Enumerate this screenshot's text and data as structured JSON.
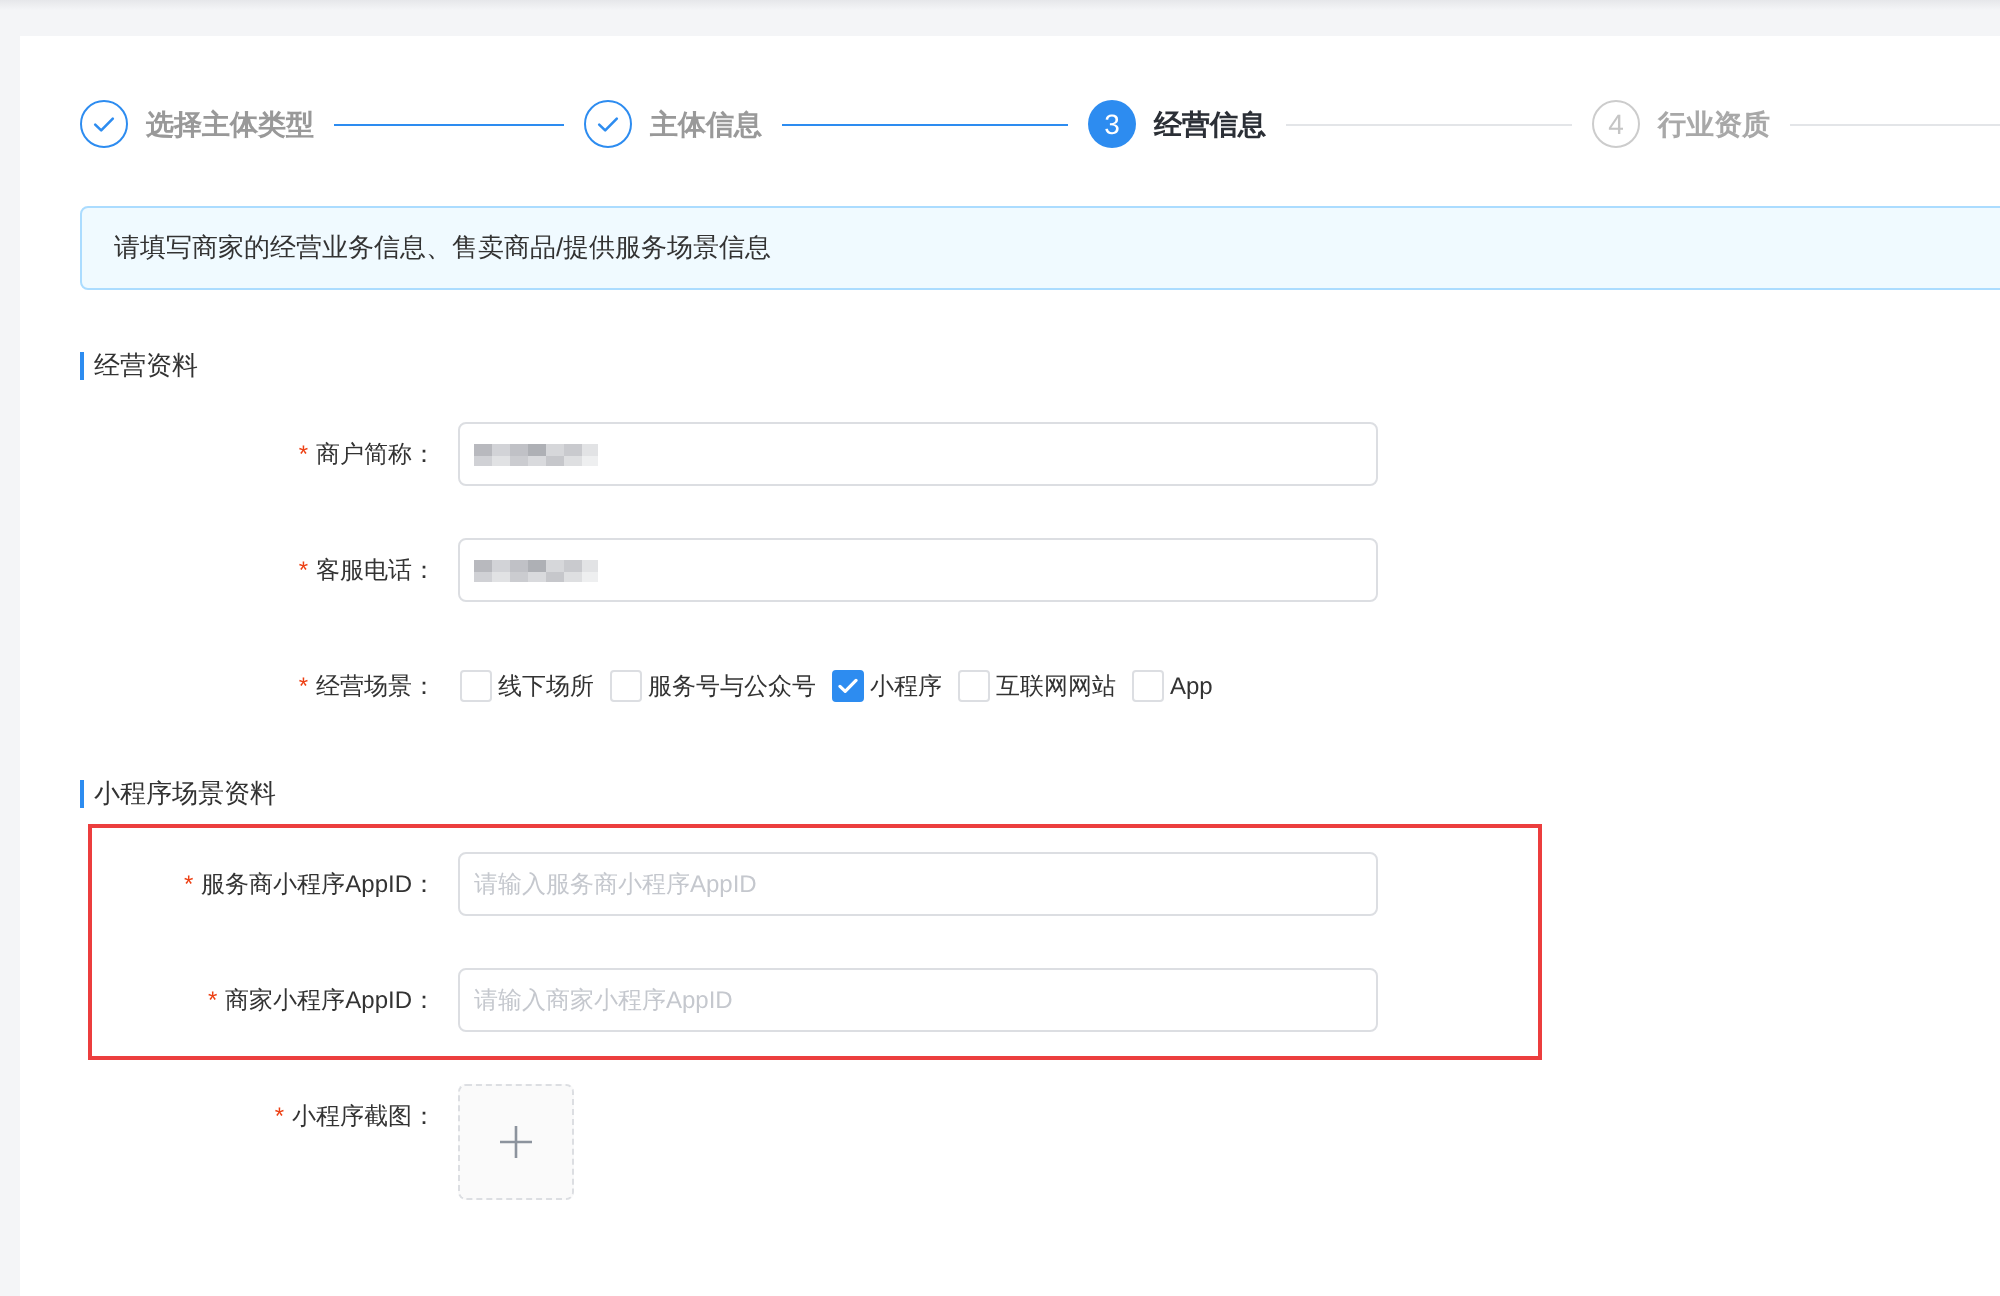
{
  "steps": [
    {
      "title": "选择主体类型",
      "completed": true,
      "selected": false
    },
    {
      "title": "主体信息",
      "completed": true,
      "selected": false
    },
    {
      "number": "3",
      "title": "经营信息",
      "completed": false,
      "selected": true
    },
    {
      "number": "4",
      "title": "行业资质",
      "completed": false,
      "selected": false
    }
  ],
  "alert": {
    "text": "请填写商家的经营业务信息、售卖商品/提供服务场景信息"
  },
  "sections": [
    {
      "title": "经营资料",
      "fields": [
        {
          "kind": "input",
          "mark": "*",
          "label": "商户简称：",
          "value_blurred": true,
          "highlighted": false
        },
        {
          "kind": "input",
          "mark": "*",
          "label": "客服电话：",
          "value_blurred": true,
          "highlighted": false
        },
        {
          "kind": "checkboxes",
          "mark": "*",
          "label": "经营场景：",
          "highlighted": false,
          "options": [
            {
              "label": "线下场所",
              "checked": false
            },
            {
              "label": "服务号与公众号",
              "checked": false
            },
            {
              "label": "小程序",
              "checked": true
            },
            {
              "label": "互联网网站",
              "checked": false
            },
            {
              "label": "App",
              "checked": false
            }
          ]
        }
      ]
    },
    {
      "title": "小程序场景资料",
      "fields": [
        {
          "kind": "input",
          "mark": "*",
          "label": "服务商小程序AppID：",
          "placeholder": "请输入服务商小程序AppID",
          "highlighted": true
        },
        {
          "kind": "input",
          "mark": "*",
          "label": "商家小程序AppID：",
          "placeholder": "请输入商家小程序AppID",
          "highlighted": true
        },
        {
          "kind": "upload",
          "mark": "*",
          "label": "小程序截图：",
          "highlighted": false
        }
      ]
    }
  ]
}
